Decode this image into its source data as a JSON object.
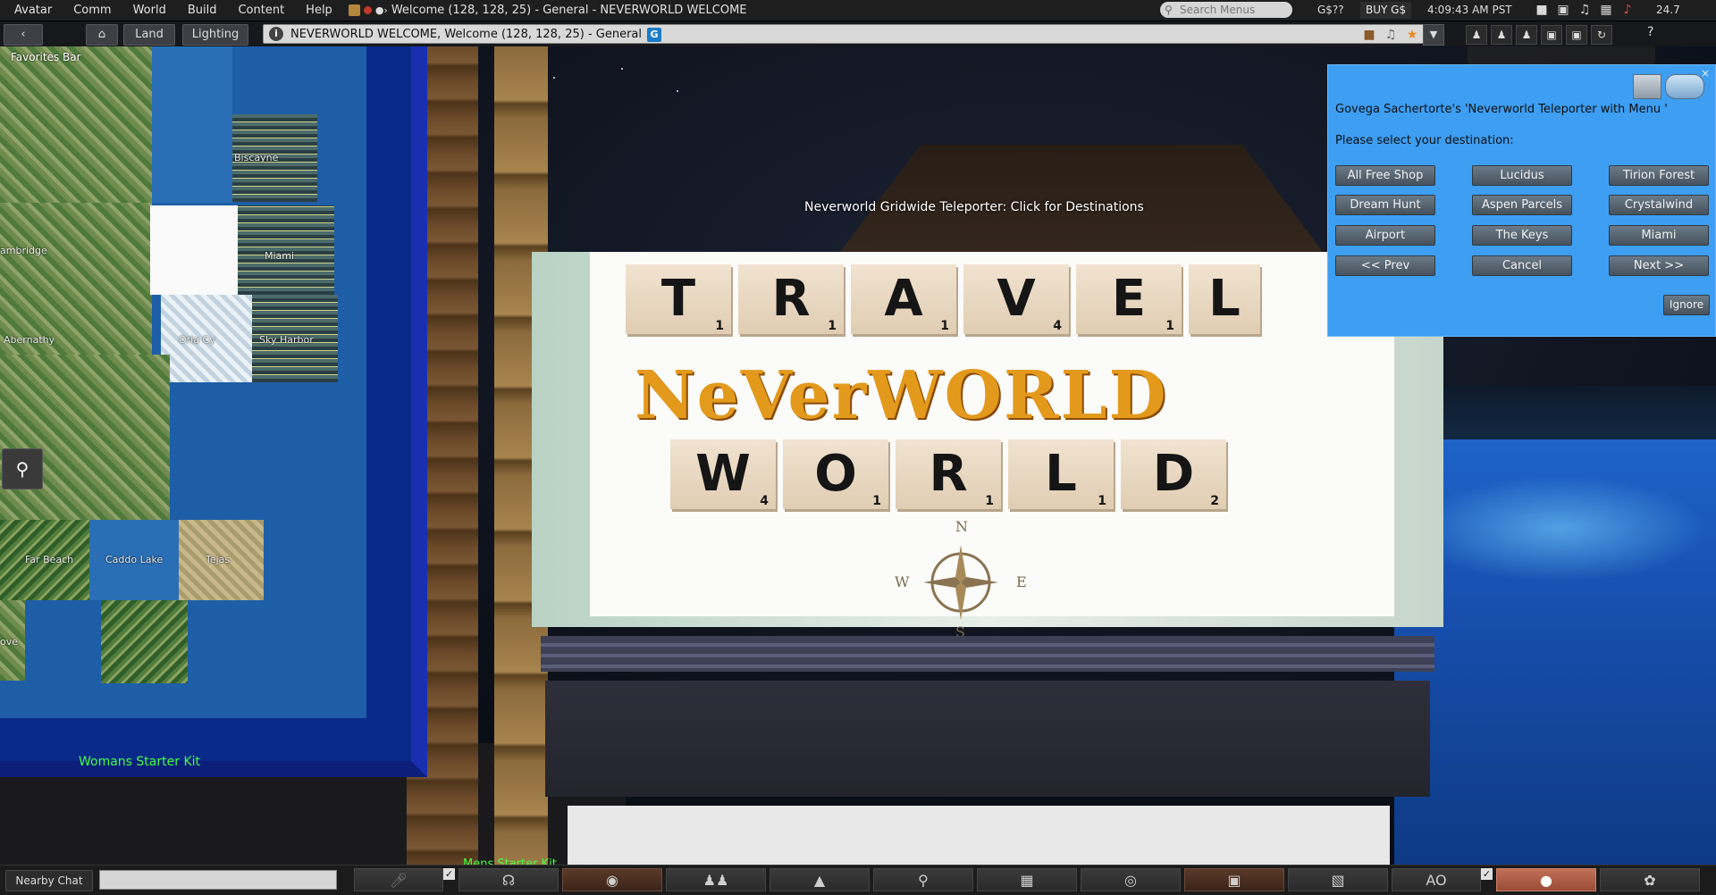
{
  "menubar": {
    "items": [
      "Avatar",
      "Comm",
      "World",
      "Build",
      "Content",
      "Help"
    ],
    "window_title": "Welcome (128, 128, 25) - General - NEVERWORLD WELCOME",
    "search_placeholder": "Search Menus",
    "balance": "G$??",
    "buy_label": "BUY G$",
    "clock": "4:09:43 AM PST",
    "fps": "24.7"
  },
  "navbar": {
    "land_label": "Land",
    "lighting_label": "Lighting",
    "location": "NEVERWORLD WELCOME, Welcome (128, 128, 25) - General",
    "badge": "G",
    "favorites_label": "Favorites Bar"
  },
  "scene": {
    "floating_text": "Neverworld Gridwide Teleporter: Click for Destinations",
    "hover_text_1": "Womans Starter Kit",
    "hover_text_2": "Mens Starter Kit",
    "sign": {
      "row1": [
        [
          "T",
          "1"
        ],
        [
          "R",
          "1"
        ],
        [
          "A",
          "1"
        ],
        [
          "V",
          "4"
        ],
        [
          "E",
          "1"
        ],
        [
          "L",
          ""
        ]
      ],
      "title": "NeVerWORLD",
      "row3": [
        [
          "W",
          "4"
        ],
        [
          "O",
          "1"
        ],
        [
          "R",
          "1"
        ],
        [
          "L",
          "1"
        ],
        [
          "D",
          "2"
        ]
      ],
      "compass": {
        "n": "N",
        "s": "S",
        "e": "E",
        "w": "W"
      }
    },
    "map_labels": [
      "Biscayne",
      "ambridge",
      "Miami",
      "Abernathy",
      "Orla Cy",
      "Sky Harbor",
      "Far Beach",
      "Caddo Lake",
      "Tejas",
      "ove"
    ]
  },
  "dialog": {
    "title": "Govega Sachertorte's 'Neverworld Teleporter with Menu '",
    "prompt": "Please select your destination:",
    "buttons": [
      [
        "All Free Shop",
        "Lucidus",
        "Tirion Forest"
      ],
      [
        "Dream Hunt",
        "Aspen Parcels",
        "Crystalwind"
      ],
      [
        "Airport",
        "The Keys",
        "Miami"
      ],
      [
        "<< Prev",
        "Cancel",
        "Next >>"
      ]
    ],
    "ignore_label": "Ignore",
    "close_glyph": "×"
  },
  "bottombar": {
    "chat_label": "Nearby Chat",
    "ao_label": "AO",
    "icons": [
      "microphone-icon",
      "headphones-icon",
      "eye-icon",
      "people-icon",
      "shirt-icon",
      "search-icon",
      "map-icon",
      "radar-icon",
      "camera-icon",
      "inventory-icon",
      "ao",
      "chat-bubble-icon",
      "logo-icon"
    ]
  }
}
